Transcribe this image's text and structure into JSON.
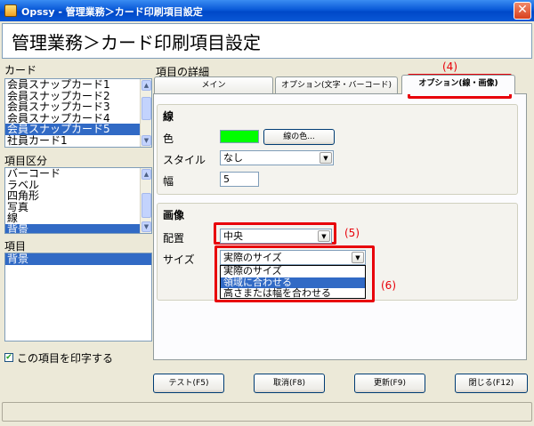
{
  "window": {
    "title": "Opssy - 管理業務＞カード印刷項目設定",
    "close": "✕",
    "page_title": "管理業務＞カード印刷項目設定"
  },
  "left": {
    "card_label": "カード",
    "card_items": [
      "会員スナップカード1",
      "会員スナップカード2",
      "会員スナップカード3",
      "会員スナップカード4",
      "会員スナップカード5",
      "社員カード1"
    ],
    "card_selected": "会員スナップカード5",
    "category_label": "項目区分",
    "category_items": [
      "バーコード",
      "ラベル",
      "四角形",
      "写真",
      "線",
      "背景"
    ],
    "category_selected": "背景",
    "item_label": "項目",
    "item_items": [
      "背景"
    ],
    "print_checkbox_label": "この項目を印字する",
    "print_checked": true
  },
  "detail": {
    "label": "項目の詳細",
    "tabs": [
      {
        "label": "メイン"
      },
      {
        "label": "オプション(文字・バーコード)"
      },
      {
        "label": "オプション(線・画像)"
      }
    ],
    "active_tab": "オプション(線・画像)",
    "line_group": {
      "title": "線",
      "color_label": "色",
      "color_value": "#00ff00",
      "color_button": "線の色...",
      "style_label": "スタイル",
      "style_value": "なし",
      "width_label": "幅",
      "width_value": "5"
    },
    "image_group": {
      "title": "画像",
      "placement_label": "配置",
      "placement_value": "中央",
      "size_label": "サイズ",
      "size_value": "実際のサイズ",
      "size_options": [
        "実際のサイズ",
        "領域に合わせる",
        "高さまたは幅を合わせる"
      ],
      "size_highlighted": "領域に合わせる"
    }
  },
  "annotations": {
    "a4": "(4)",
    "a5": "(5)",
    "a6": "(6)"
  },
  "buttons": {
    "test": "テスト(F5)",
    "cancel": "取消(F8)",
    "update": "更新(F9)",
    "close": "閉じる(F12)"
  },
  "icons": {
    "dropdown": "▼",
    "scroll_up": "▲",
    "scroll_down": "▼",
    "check": "✔"
  },
  "colors": {
    "highlight": "#e8000a",
    "selection": "#316ac5"
  }
}
